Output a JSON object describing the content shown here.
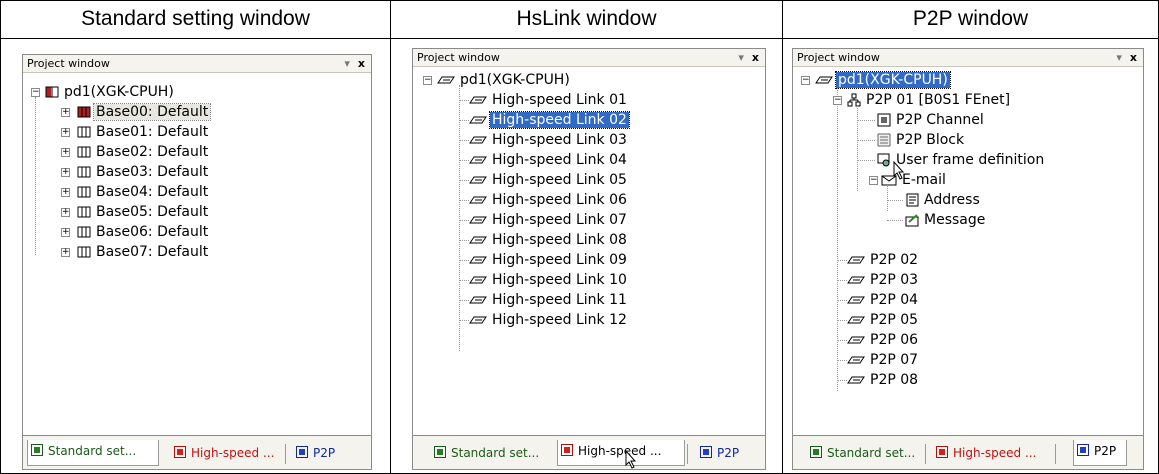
{
  "headers": [
    "Standard setting window",
    "HsLink window",
    "P2P window"
  ],
  "panel_title": "Project window",
  "panel_buttons": {
    "pin": "▾",
    "close": "x"
  },
  "std": {
    "root": "pd1(XGK-CPUH)",
    "items": [
      "Base00: Default",
      "Base01: Default",
      "Base02: Default",
      "Base03: Default",
      "Base04: Default",
      "Base05: Default",
      "Base06: Default",
      "Base07: Default"
    ],
    "selected_index": 0
  },
  "hs": {
    "root": "pd1(XGK-CPUH)",
    "items": [
      "High-speed Link 01",
      "High-speed Link 02",
      "High-speed Link 03",
      "High-speed Link 04",
      "High-speed Link 05",
      "High-speed Link 06",
      "High-speed Link 07",
      "High-speed Link 08",
      "High-speed Link 09",
      "High-speed Link 10",
      "High-speed Link 11",
      "High-speed Link 12"
    ],
    "selected_index": 1
  },
  "p2p": {
    "root": "pd1(XGK-CPUH)",
    "p2p01": "P2P 01 [B0S1 FEnet]",
    "channel": "P2P Channel",
    "block": "P2P Block",
    "userframe": "User frame definition",
    "email": "E-mail",
    "address": "Address",
    "message": "Message",
    "others": [
      "P2P 02",
      "P2P 03",
      "P2P 04",
      "P2P 05",
      "P2P 06",
      "P2P 07",
      "P2P 08"
    ]
  },
  "tabs": {
    "standard": "Standard set...",
    "highspeed": "High-speed ...",
    "p2p": "P2P"
  },
  "active_tabs": [
    "standard",
    "highspeed",
    "p2p"
  ]
}
